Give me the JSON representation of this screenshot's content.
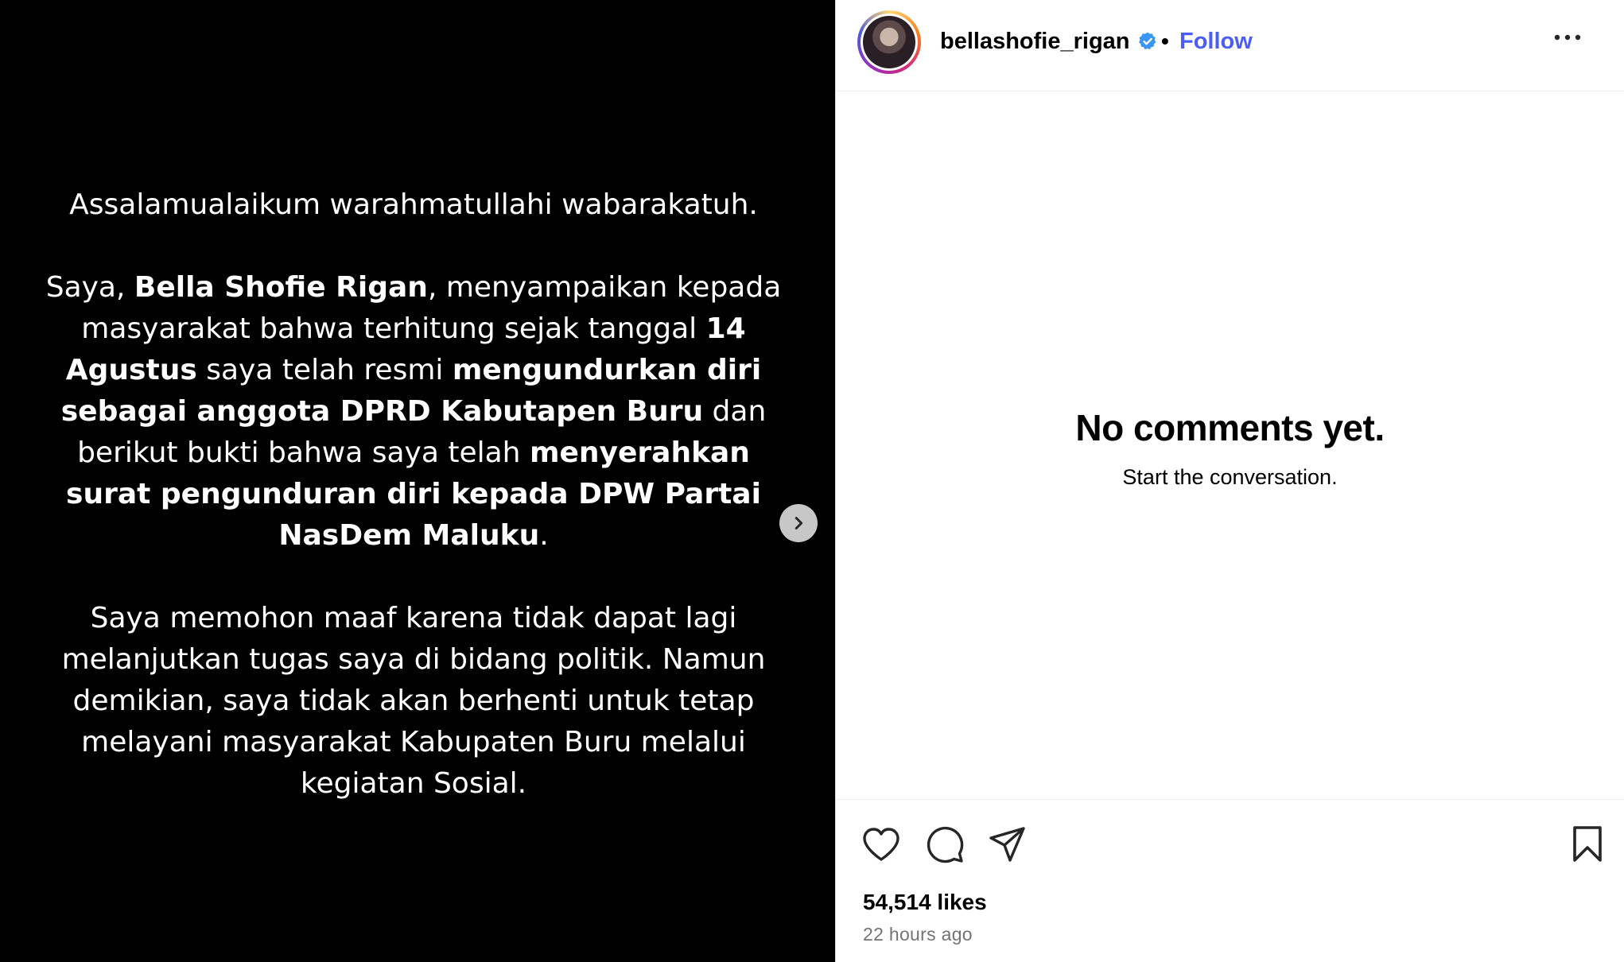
{
  "post": {
    "media": {
      "greeting": "Assalamualaikum warahmatullahi wabarakatuh.",
      "p2": {
        "t1": "Saya, ",
        "b1": "Bella Shofie Rigan",
        "t2": ", menyampaikan kepada masyarakat bahwa terhitung sejak tanggal ",
        "b2": "14 Agustus",
        "t3": " saya telah resmi ",
        "b3": "mengundurkan diri sebagai anggota DPRD Kabutapen Buru",
        "t4": " dan berikut bukti bahwa saya telah ",
        "b4": "menyerahkan surat pengunduran diri kepada DPW Partai NasDem Maluku",
        "t5": "."
      },
      "p3": "Saya memohon maaf karena tidak dapat lagi melanjutkan tugas saya di bidang politik. Namun demikian, saya tidak akan berhenti untuk tetap melayani masyarakat Kabupaten Buru melalui kegiatan Sosial."
    },
    "next_icon": "chevron-right-icon"
  },
  "header": {
    "username": "bellashofie_rigan",
    "separator": "•",
    "follow_label": "Follow",
    "verified_icon": "verified-badge-icon",
    "more_icon": "more-horizontal-icon"
  },
  "comments": {
    "empty_title": "No comments yet.",
    "empty_subtitle": "Start the conversation."
  },
  "actions": {
    "icons": [
      "heart-icon",
      "comment-icon",
      "share-icon",
      "bookmark-icon"
    ],
    "likes": "54,514 likes",
    "time": "22 hours ago"
  },
  "colors": {
    "link": "#4a5df9",
    "verified": "#3897f0",
    "muted": "#737373"
  }
}
